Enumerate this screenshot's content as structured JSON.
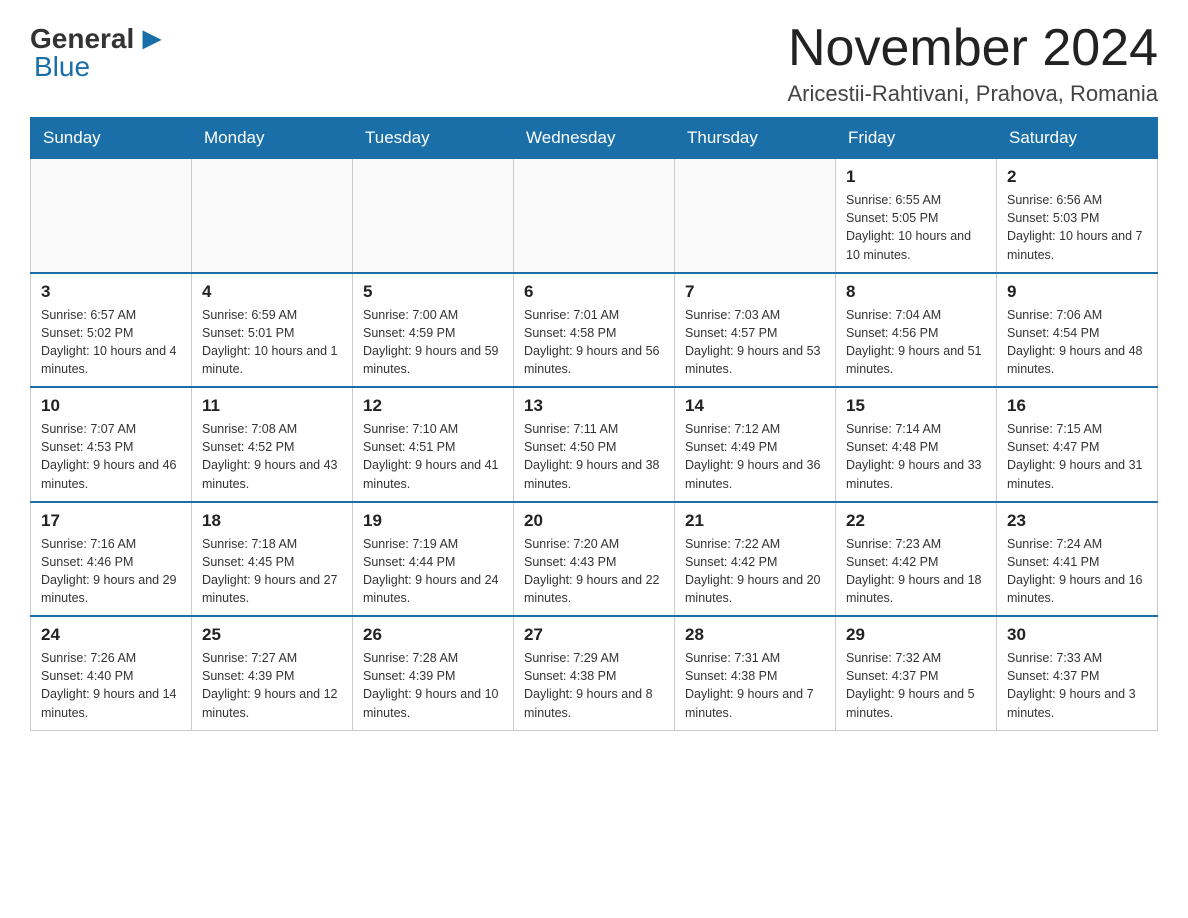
{
  "logo": {
    "general": "General",
    "blue": "Blue"
  },
  "title": "November 2024",
  "location": "Aricestii-Rahtivani, Prahova, Romania",
  "weekdays": [
    "Sunday",
    "Monday",
    "Tuesday",
    "Wednesday",
    "Thursday",
    "Friday",
    "Saturday"
  ],
  "weeks": [
    [
      {
        "day": "",
        "sunrise": "",
        "sunset": "",
        "daylight": ""
      },
      {
        "day": "",
        "sunrise": "",
        "sunset": "",
        "daylight": ""
      },
      {
        "day": "",
        "sunrise": "",
        "sunset": "",
        "daylight": ""
      },
      {
        "day": "",
        "sunrise": "",
        "sunset": "",
        "daylight": ""
      },
      {
        "day": "",
        "sunrise": "",
        "sunset": "",
        "daylight": ""
      },
      {
        "day": "1",
        "sunrise": "Sunrise: 6:55 AM",
        "sunset": "Sunset: 5:05 PM",
        "daylight": "Daylight: 10 hours and 10 minutes."
      },
      {
        "day": "2",
        "sunrise": "Sunrise: 6:56 AM",
        "sunset": "Sunset: 5:03 PM",
        "daylight": "Daylight: 10 hours and 7 minutes."
      }
    ],
    [
      {
        "day": "3",
        "sunrise": "Sunrise: 6:57 AM",
        "sunset": "Sunset: 5:02 PM",
        "daylight": "Daylight: 10 hours and 4 minutes."
      },
      {
        "day": "4",
        "sunrise": "Sunrise: 6:59 AM",
        "sunset": "Sunset: 5:01 PM",
        "daylight": "Daylight: 10 hours and 1 minute."
      },
      {
        "day": "5",
        "sunrise": "Sunrise: 7:00 AM",
        "sunset": "Sunset: 4:59 PM",
        "daylight": "Daylight: 9 hours and 59 minutes."
      },
      {
        "day": "6",
        "sunrise": "Sunrise: 7:01 AM",
        "sunset": "Sunset: 4:58 PM",
        "daylight": "Daylight: 9 hours and 56 minutes."
      },
      {
        "day": "7",
        "sunrise": "Sunrise: 7:03 AM",
        "sunset": "Sunset: 4:57 PM",
        "daylight": "Daylight: 9 hours and 53 minutes."
      },
      {
        "day": "8",
        "sunrise": "Sunrise: 7:04 AM",
        "sunset": "Sunset: 4:56 PM",
        "daylight": "Daylight: 9 hours and 51 minutes."
      },
      {
        "day": "9",
        "sunrise": "Sunrise: 7:06 AM",
        "sunset": "Sunset: 4:54 PM",
        "daylight": "Daylight: 9 hours and 48 minutes."
      }
    ],
    [
      {
        "day": "10",
        "sunrise": "Sunrise: 7:07 AM",
        "sunset": "Sunset: 4:53 PM",
        "daylight": "Daylight: 9 hours and 46 minutes."
      },
      {
        "day": "11",
        "sunrise": "Sunrise: 7:08 AM",
        "sunset": "Sunset: 4:52 PM",
        "daylight": "Daylight: 9 hours and 43 minutes."
      },
      {
        "day": "12",
        "sunrise": "Sunrise: 7:10 AM",
        "sunset": "Sunset: 4:51 PM",
        "daylight": "Daylight: 9 hours and 41 minutes."
      },
      {
        "day": "13",
        "sunrise": "Sunrise: 7:11 AM",
        "sunset": "Sunset: 4:50 PM",
        "daylight": "Daylight: 9 hours and 38 minutes."
      },
      {
        "day": "14",
        "sunrise": "Sunrise: 7:12 AM",
        "sunset": "Sunset: 4:49 PM",
        "daylight": "Daylight: 9 hours and 36 minutes."
      },
      {
        "day": "15",
        "sunrise": "Sunrise: 7:14 AM",
        "sunset": "Sunset: 4:48 PM",
        "daylight": "Daylight: 9 hours and 33 minutes."
      },
      {
        "day": "16",
        "sunrise": "Sunrise: 7:15 AM",
        "sunset": "Sunset: 4:47 PM",
        "daylight": "Daylight: 9 hours and 31 minutes."
      }
    ],
    [
      {
        "day": "17",
        "sunrise": "Sunrise: 7:16 AM",
        "sunset": "Sunset: 4:46 PM",
        "daylight": "Daylight: 9 hours and 29 minutes."
      },
      {
        "day": "18",
        "sunrise": "Sunrise: 7:18 AM",
        "sunset": "Sunset: 4:45 PM",
        "daylight": "Daylight: 9 hours and 27 minutes."
      },
      {
        "day": "19",
        "sunrise": "Sunrise: 7:19 AM",
        "sunset": "Sunset: 4:44 PM",
        "daylight": "Daylight: 9 hours and 24 minutes."
      },
      {
        "day": "20",
        "sunrise": "Sunrise: 7:20 AM",
        "sunset": "Sunset: 4:43 PM",
        "daylight": "Daylight: 9 hours and 22 minutes."
      },
      {
        "day": "21",
        "sunrise": "Sunrise: 7:22 AM",
        "sunset": "Sunset: 4:42 PM",
        "daylight": "Daylight: 9 hours and 20 minutes."
      },
      {
        "day": "22",
        "sunrise": "Sunrise: 7:23 AM",
        "sunset": "Sunset: 4:42 PM",
        "daylight": "Daylight: 9 hours and 18 minutes."
      },
      {
        "day": "23",
        "sunrise": "Sunrise: 7:24 AM",
        "sunset": "Sunset: 4:41 PM",
        "daylight": "Daylight: 9 hours and 16 minutes."
      }
    ],
    [
      {
        "day": "24",
        "sunrise": "Sunrise: 7:26 AM",
        "sunset": "Sunset: 4:40 PM",
        "daylight": "Daylight: 9 hours and 14 minutes."
      },
      {
        "day": "25",
        "sunrise": "Sunrise: 7:27 AM",
        "sunset": "Sunset: 4:39 PM",
        "daylight": "Daylight: 9 hours and 12 minutes."
      },
      {
        "day": "26",
        "sunrise": "Sunrise: 7:28 AM",
        "sunset": "Sunset: 4:39 PM",
        "daylight": "Daylight: 9 hours and 10 minutes."
      },
      {
        "day": "27",
        "sunrise": "Sunrise: 7:29 AM",
        "sunset": "Sunset: 4:38 PM",
        "daylight": "Daylight: 9 hours and 8 minutes."
      },
      {
        "day": "28",
        "sunrise": "Sunrise: 7:31 AM",
        "sunset": "Sunset: 4:38 PM",
        "daylight": "Daylight: 9 hours and 7 minutes."
      },
      {
        "day": "29",
        "sunrise": "Sunrise: 7:32 AM",
        "sunset": "Sunset: 4:37 PM",
        "daylight": "Daylight: 9 hours and 5 minutes."
      },
      {
        "day": "30",
        "sunrise": "Sunrise: 7:33 AM",
        "sunset": "Sunset: 4:37 PM",
        "daylight": "Daylight: 9 hours and 3 minutes."
      }
    ]
  ]
}
